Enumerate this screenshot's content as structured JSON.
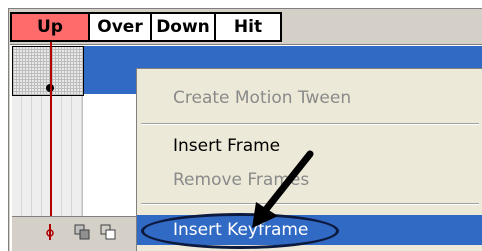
{
  "states": [
    {
      "label": "Up",
      "active": true
    },
    {
      "label": "Over",
      "active": false
    },
    {
      "label": "Down",
      "active": false
    },
    {
      "label": "Hit",
      "active": false
    }
  ],
  "context_menu": {
    "items": [
      {
        "label": "Create Motion Tween",
        "disabled": true
      },
      {
        "label": "Insert Frame",
        "disabled": false
      },
      {
        "label": "Remove Frames",
        "disabled": true,
        "partially_obscured": true
      },
      {
        "label": "Insert Keyframe",
        "disabled": false,
        "selected": true
      }
    ]
  },
  "icons": {
    "onion_skin": "onion-skin-icon",
    "onion_outline": "onion-skin-outline-icon",
    "center_frame": "center-frame-icon",
    "pointer_arrow": "pointer-arrow-icon"
  },
  "colors": {
    "active_state": "#ff6b6b",
    "selection": "#316ac5",
    "playhead": "#b00000",
    "menu_bg": "#ece9d8"
  }
}
